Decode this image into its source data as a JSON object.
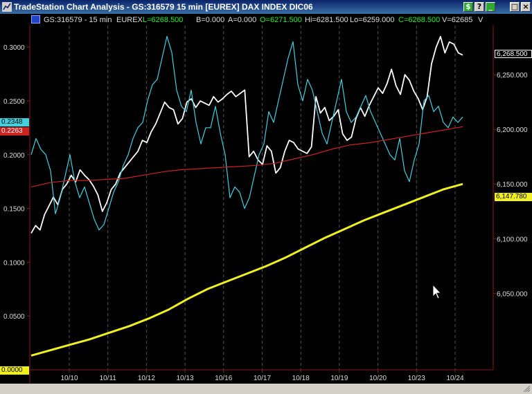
{
  "window": {
    "title": "TradeStation Chart Analysis - GS:316579  15 min  [EUREX] DAX INDEX DIC06",
    "buttons": [
      "$",
      "?",
      "_",
      "□",
      "×"
    ]
  },
  "statusline": {
    "symbol": "GS:316579 - 15 min",
    "exchange": "EUREX",
    "last": "L=6268.500",
    "bid": "B=0.000",
    "ask": "A=0.000",
    "open": "O=6271.500",
    "high": "Hi=6281.500",
    "low": "Lo=6259.000",
    "close": "C=6268.500",
    "volume": "V=62685",
    "trailing": "V",
    "colors": {
      "last": "#22ee22",
      "open": "#22ee22",
      "close": "#22ee22",
      "text": "#dddddd"
    }
  },
  "chart_data": {
    "type": "line",
    "x_labels": [
      "10/10",
      "10/11",
      "10/12",
      "10/13",
      "10/16",
      "10/17",
      "10/18",
      "10/19",
      "10/20",
      "10/23",
      "10/24"
    ],
    "left_axis": {
      "ticks": [
        "0.3000",
        "0.2500",
        "0.2000",
        "0.1500",
        "0.1000",
        "0.0500"
      ],
      "range": [
        0.0,
        0.32
      ]
    },
    "right_axis": {
      "ticks": [
        "6,250.000",
        "6,200.000",
        "6,150.000",
        "6,100.000",
        "6,050.000"
      ],
      "range": [
        5980,
        6295
      ]
    },
    "flags": {
      "left_cyan": "0.2348",
      "left_red": "0.2263",
      "left_zero": "0.0000",
      "right_price": "6,268.500",
      "right_yellow": "6,147.780"
    },
    "series": [
      {
        "axis": "right",
        "color": "#ffffff",
        "values": [
          6105,
          6112,
          6108,
          6122,
          6130,
          6138,
          6131,
          6145,
          6150,
          6158,
          6152,
          6163,
          6158,
          6154,
          6148,
          6140,
          6125,
          6133,
          6145,
          6150,
          6160,
          6165,
          6170,
          6175,
          6180,
          6190,
          6188,
          6198,
          6205,
          6215,
          6225,
          6220,
          6218,
          6205,
          6210,
          6225,
          6228,
          6220,
          6226,
          6224,
          6222,
          6230,
          6225,
          6228,
          6232,
          6235,
          6230,
          6233,
          6236,
          6175,
          6180,
          6172,
          6168,
          6185,
          6180,
          6160,
          6165,
          6180,
          6190,
          6188,
          6182,
          6180,
          6178,
          6184,
          6230,
          6215,
          6220,
          6208,
          6212,
          6218,
          6196,
          6190,
          6193,
          6210,
          6220,
          6212,
          6222,
          6230,
          6238,
          6233,
          6242,
          6255,
          6240,
          6232,
          6250,
          6245,
          6235,
          6228,
          6218,
          6230,
          6260,
          6275,
          6285,
          6270,
          6280,
          6278,
          6270,
          6268
        ]
      },
      {
        "axis": "left",
        "color": "#40d0e0",
        "values": [
          0.2,
          0.215,
          0.205,
          0.2,
          0.185,
          0.145,
          0.16,
          0.18,
          0.2,
          0.175,
          0.16,
          0.17,
          0.155,
          0.14,
          0.13,
          0.135,
          0.15,
          0.165,
          0.175,
          0.19,
          0.2,
          0.215,
          0.225,
          0.23,
          0.25,
          0.265,
          0.27,
          0.29,
          0.31,
          0.295,
          0.26,
          0.245,
          0.24,
          0.26,
          0.23,
          0.21,
          0.225,
          0.225,
          0.245,
          0.22,
          0.2,
          0.16,
          0.17,
          0.165,
          0.15,
          0.16,
          0.18,
          0.2,
          0.21,
          0.24,
          0.23,
          0.25,
          0.27,
          0.29,
          0.305,
          0.265,
          0.25,
          0.27,
          0.26,
          0.24,
          0.22,
          0.21,
          0.23,
          0.25,
          0.27,
          0.24,
          0.23,
          0.235,
          0.245,
          0.255,
          0.24,
          0.23,
          0.22,
          0.21,
          0.2,
          0.195,
          0.215,
          0.185,
          0.175,
          0.195,
          0.21,
          0.25,
          0.255,
          0.24,
          0.245,
          0.23,
          0.225,
          0.235,
          0.23,
          0.235
        ]
      },
      {
        "axis": "left",
        "color": "#cc2222",
        "values": [
          0.17,
          0.174,
          0.176,
          0.176,
          0.177,
          0.178,
          0.181,
          0.184,
          0.186,
          0.187,
          0.188,
          0.189,
          0.19,
          0.192,
          0.196,
          0.2,
          0.205,
          0.209,
          0.211,
          0.214,
          0.217,
          0.22,
          0.223,
          0.226
        ]
      },
      {
        "axis": "right",
        "color": "#f0f020",
        "values": [
          5993,
          5998,
          6003,
          6008,
          6014,
          6020,
          6027,
          6035,
          6045,
          6054,
          6061,
          6068,
          6075,
          6083,
          6092,
          6101,
          6109,
          6117,
          6124,
          6131,
          6138,
          6145,
          6150
        ]
      }
    ]
  }
}
